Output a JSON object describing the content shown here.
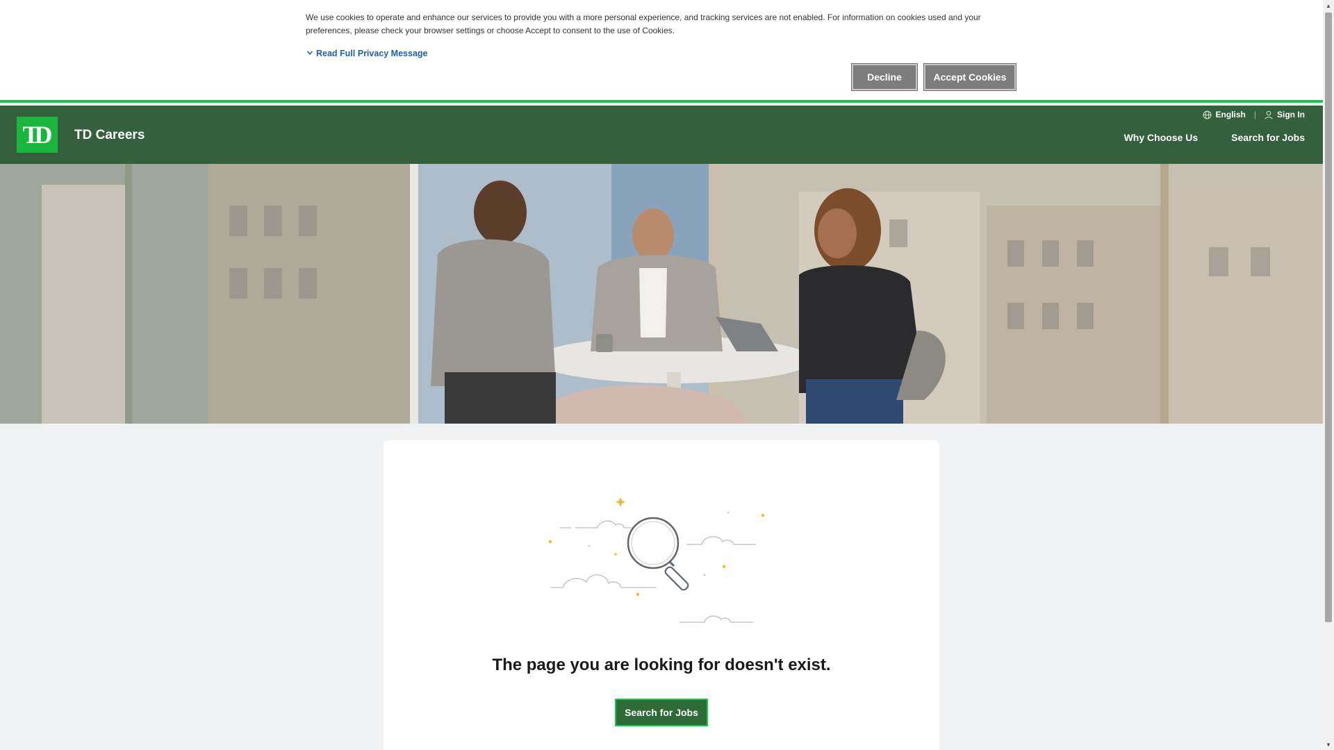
{
  "cookie_banner": {
    "text": "We use cookies to operate and enhance our services to provide you with a more personal experience, and tracking services are not enabled. For information on cookies used and your preferences, please check your browser settings or choose Accept to consent to the use of Cookies.",
    "privacy_link": "Read Full Privacy Message",
    "decline_label": "Decline",
    "accept_label": "Accept Cookies"
  },
  "header": {
    "logo_text": "TD",
    "brand": "TD Careers",
    "language": "English",
    "sign_in": "Sign In",
    "nav": [
      "Why Choose Us",
      "Search for Jobs"
    ]
  },
  "hero": {
    "image": "photo of three colleagues meeting at a round table by large office windows"
  },
  "main": {
    "message": "The page you are looking for doesn't exist.",
    "button_label": "Search for Jobs"
  },
  "colors": {
    "header_green": "#34603b",
    "logo_green": "#18b63d",
    "accent_green": "#1cc54e",
    "link_blue": "#1a5fb4",
    "button_gray": "#7d7d7d"
  },
  "icons": [
    "chevron-down-icon",
    "globe-icon",
    "user-icon",
    "magnifier-illustration"
  ]
}
